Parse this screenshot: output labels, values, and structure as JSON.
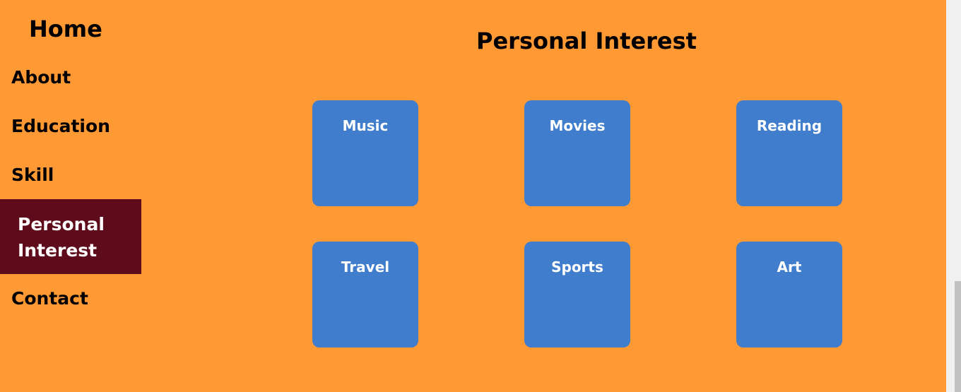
{
  "sidebar": {
    "home_label": "Home",
    "items": [
      {
        "label": "About"
      },
      {
        "label": "Education"
      },
      {
        "label": "Skill"
      },
      {
        "label_line1": "Personal",
        "label_line2": "Interest",
        "active": true
      },
      {
        "label": "Contact"
      }
    ],
    "active_color": "#5e0b1b"
  },
  "main": {
    "title": "Personal Interest",
    "cards": [
      {
        "label": "Music"
      },
      {
        "label": "Movies"
      },
      {
        "label": "Reading"
      },
      {
        "label": "Travel"
      },
      {
        "label": "Sports"
      },
      {
        "label": "Art"
      }
    ]
  },
  "colors": {
    "background": "#ff9933",
    "card": "#407dcc"
  }
}
